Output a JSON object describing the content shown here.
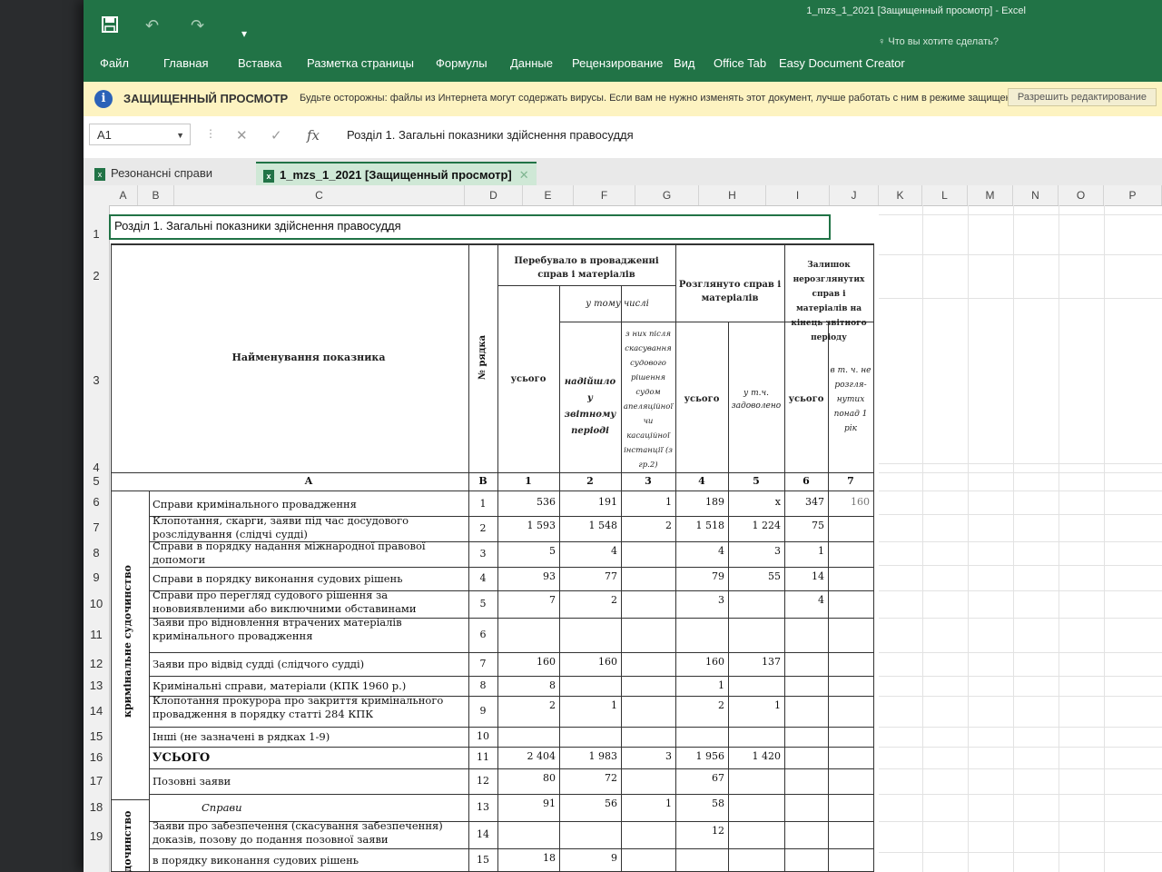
{
  "titlebar": {
    "quick_access": [
      "save-icon",
      "undo-icon",
      "redo-icon",
      "customize-icon"
    ],
    "tabs": [
      "Файл",
      "Главная",
      "Вставка",
      "Разметка страницы",
      "Формулы",
      "Данные",
      "Рецензирование",
      "Вид",
      "Office Tab",
      "Easy Document Creator"
    ],
    "document_title": "1_mzs_1_2021 [Защищенный просмотр] - Excel",
    "tell_me": "Что вы хотите сделать?",
    "accent": "#217346"
  },
  "protected_view": {
    "title": "ЗАЩИЩЕННЫЙ ПРОСМОТР",
    "message": "Будьте осторожны: файлы из Интернета могут содержать вирусы. Если вам не нужно изменять этот документ, лучше работать с ним в режиме защищенного просмотра.",
    "button": "Разрешить редактирование"
  },
  "formula_bar": {
    "name_box": "A1",
    "formula": "Розділ 1. Загальні показники здійснення правосуддя"
  },
  "sheet_tabs": [
    {
      "label": "Резонансні справи",
      "active": false
    },
    {
      "label": "1_mzs_1_2021  [Защищенный просмотр]",
      "active": true
    }
  ],
  "columns": [
    "A",
    "B",
    "C",
    "D",
    "E",
    "F",
    "G",
    "H",
    "I",
    "J",
    "K",
    "L",
    "M",
    "N",
    "O",
    "P"
  ],
  "row_numbers": [
    "1",
    "2",
    "3",
    "4",
    "5",
    "6",
    "7",
    "8",
    "9",
    "10",
    "11",
    "12",
    "13",
    "14",
    "15",
    "16",
    "17",
    "18",
    "19"
  ],
  "sheet": {
    "title": "Розділ 1. Загальні показники здійснення правосуддя",
    "headers": {
      "name": "Найменування показника",
      "line_no": "№ рядка",
      "pending": "Перебувало в провадженні справ і матеріалів",
      "incl": "у тому числі",
      "total": "усього",
      "received": "надійшло у звітному періоді",
      "after_cancel": "з них після скасування судового рішення судом апеляційної чи касаційної інстанції (з гр.2)",
      "reviewed": "Розглянуто справ і матеріалів",
      "granted": "у т.ч. задоволено",
      "remaining": "Залишок нерозглянутих справ і матеріалів на кінець звітного періоду",
      "over_year": "в т. ч. не розгля-нутих понад 1 рік"
    },
    "index_row": [
      "А",
      "В",
      "1",
      "2",
      "3",
      "4",
      "5",
      "6",
      "7"
    ],
    "section_label": "кримінальне судочинство",
    "section2_label": "дочинство",
    "rows": [
      {
        "label": [
          "Справи кримінального провадження"
        ],
        "code": "1",
        "c1": "536",
        "c2": "191",
        "c3": "1",
        "c4": "189",
        "c5": "х",
        "c6": "347",
        "c7": "160"
      },
      {
        "label": [
          "Клопотання, скарги, заяви під час досудового",
          "розслідування (слідчі судді)"
        ],
        "code": "2",
        "c1": "1 593",
        "c2": "1 548",
        "c3": "2",
        "c4": "1 518",
        "c5": "1 224",
        "c6": "75",
        "c7": ""
      },
      {
        "label": [
          "Справи в порядку надання міжнародної правової",
          "допомоги"
        ],
        "code": "3",
        "c1": "5",
        "c2": "4",
        "c3": "",
        "c4": "4",
        "c5": "3",
        "c6": "1",
        "c7": ""
      },
      {
        "label": [
          "Справи в порядку виконання судових рішень"
        ],
        "code": "4",
        "c1": "93",
        "c2": "77",
        "c3": "",
        "c4": "79",
        "c5": "55",
        "c6": "14",
        "c7": ""
      },
      {
        "label": [
          "Справи про перегляд судового рішення за",
          "нововиявленими або виключними обставинами"
        ],
        "code": "5",
        "c1": "7",
        "c2": "2",
        "c3": "",
        "c4": "3",
        "c5": "",
        "c6": "4",
        "c7": ""
      },
      {
        "label": [
          "Заяви про відновлення втрачених матеріалів",
          "кримінального провадження"
        ],
        "code": "6",
        "c1": "",
        "c2": "",
        "c3": "",
        "c4": "",
        "c5": "",
        "c6": "",
        "c7": ""
      },
      {
        "label": [
          "Заяви про відвід судді (слідчого судді)"
        ],
        "code": "7",
        "c1": "160",
        "c2": "160",
        "c3": "",
        "c4": "160",
        "c5": "137",
        "c6": "",
        "c7": ""
      },
      {
        "label": [
          "Кримінальні справи, матеріали (КПК 1960 р.)"
        ],
        "code": "8",
        "c1": "8",
        "c2": "",
        "c3": "",
        "c4": "1",
        "c5": "",
        "c6": "",
        "c7": ""
      },
      {
        "label": [
          "Клопотання прокурора про закриття кримінального",
          "провадження в порядку статті 284 КПК"
        ],
        "code": "9",
        "c1": "2",
        "c2": "1",
        "c3": "",
        "c4": "2",
        "c5": "1",
        "c6": "",
        "c7": ""
      },
      {
        "label": [
          "Інші (не зазначені  в рядках 1-9)"
        ],
        "code": "10",
        "c1": "",
        "c2": "",
        "c3": "",
        "c4": "",
        "c5": "",
        "c6": "",
        "c7": ""
      },
      {
        "label": [
          "УСЬОГО"
        ],
        "code": "11",
        "c1": "2 404",
        "c2": "1 983",
        "c3": "3",
        "c4": "1 956",
        "c5": "1 420",
        "c6": "",
        "c7": ""
      },
      {
        "label": [
          "Позовні заяви"
        ],
        "code": "12",
        "c1": "80",
        "c2": "72",
        "c3": "",
        "c4": "67",
        "c5": "",
        "c6": "",
        "c7": ""
      },
      {
        "label": [
          "Справи"
        ],
        "code": "13",
        "c1": "91",
        "c2": "56",
        "c3": "1",
        "c4": "58",
        "c5": "",
        "c6": "",
        "c7": ""
      },
      {
        "label": [
          "Заяви про забезпечення (скасування забезпечення)",
          "доказів, позову до подання позовної заяви"
        ],
        "code": "14",
        "c1": "",
        "c2": "",
        "c3": "",
        "c4": "12",
        "c5": "",
        "c6": "",
        "c7": ""
      },
      {
        "label": [
          "в порядку виконання судових рішень"
        ],
        "code": "15",
        "c1": "18",
        "c2": "9",
        "c3": "",
        "c4": "",
        "c5": "",
        "c6": "",
        "c7": ""
      }
    ]
  }
}
